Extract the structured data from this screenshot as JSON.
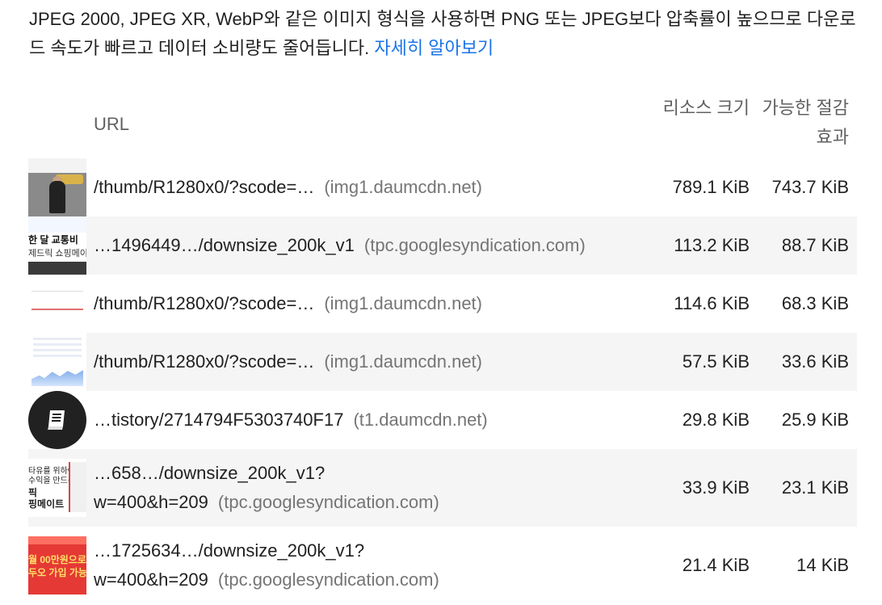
{
  "description": {
    "text": "JPEG 2000, JPEG XR, WebP와 같은 이미지 형식을 사용하면 PNG 또는 JPEG보다 압축률이 높으므로 다운로드 속도가 빠르고 데이터 소비량도 줄어듭니다.",
    "link_label": "자세히 알아보기"
  },
  "table": {
    "headers": {
      "url": "URL",
      "resource_size": "리소스 크기",
      "potential_savings": "가능한 절감 효과"
    },
    "rows": [
      {
        "url": "/thumb/R1280x0/?scode=…",
        "origin": "(img1.daumcdn.net)",
        "resource_size": "789.1 KiB",
        "savings": "743.7 KiB",
        "thumb_icon": "thumbnail-image"
      },
      {
        "url": "…1496449…/downsize_200k_v1",
        "origin": "(tpc.googlesyndication.com)",
        "resource_size": "113.2 KiB",
        "savings": "88.7 KiB",
        "thumb_icon": "thumbnail-image",
        "thumb_text_1": "한 달 교통비",
        "thumb_text_2": "제드릭 쇼핑메이트로"
      },
      {
        "url": "/thumb/R1280x0/?scode=…",
        "origin": "(img1.daumcdn.net)",
        "resource_size": "114.6 KiB",
        "savings": "68.3 KiB",
        "thumb_icon": "thumbnail-image"
      },
      {
        "url": "/thumb/R1280x0/?scode=…",
        "origin": "(img1.daumcdn.net)",
        "resource_size": "57.5 KiB",
        "savings": "33.6 KiB",
        "thumb_icon": "thumbnail-image"
      },
      {
        "url": "…tistory/2714794F5303740F17",
        "origin": "(t1.daumcdn.net)",
        "resource_size": "29.8 KiB",
        "savings": "25.9 KiB",
        "thumb_icon": "book-icon"
      },
      {
        "url_line1": "…658…/downsize_200k_v1?",
        "url_line2": "w=400&h=209",
        "origin": "(tpc.googlesyndication.com)",
        "resource_size": "33.9 KiB",
        "savings": "23.1 KiB",
        "thumb_icon": "thumbnail-image",
        "thumb_text_1": "타유를 위하여!",
        "thumb_text_2": "수익을 만드는",
        "thumb_text_3": "픽",
        "thumb_text_4": "핑메이트"
      },
      {
        "url_line1": "…1725634…/downsize_200k_v1?",
        "url_line2": "w=400&h=209",
        "origin": "(tpc.googlesyndication.com)",
        "resource_size": "21.4 KiB",
        "savings": "14 KiB",
        "thumb_icon": "thumbnail-image",
        "thumb_text_1": "월 00만원으로",
        "thumb_text_2": "두오 가입 가능해?"
      }
    ]
  },
  "colors": {
    "link": "#1a73e8",
    "alt_row": "#f5f5f5",
    "origin_text": "#757575",
    "header_text": "#616161"
  }
}
